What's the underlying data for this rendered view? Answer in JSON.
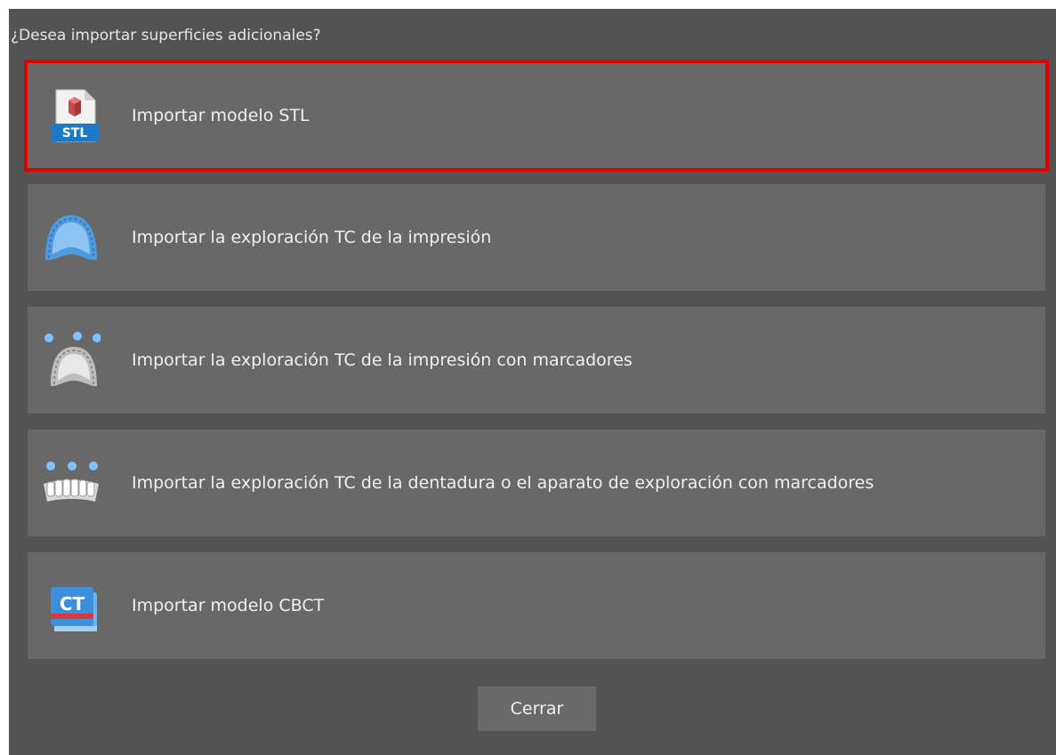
{
  "dialog": {
    "question": "¿Desea importar superficies adicionales?",
    "options": [
      {
        "label": "Importar modelo STL",
        "icon": "stl-file-icon",
        "selected": true
      },
      {
        "label": "Importar la exploración TC de la impresión",
        "icon": "impression-icon",
        "selected": false
      },
      {
        "label": "Importar la exploración TC de la impresión con marcadores",
        "icon": "impression-markers-icon",
        "selected": false
      },
      {
        "label": "Importar la exploración TC de la dentadura o el aparato de exploración con marcadores",
        "icon": "denture-markers-icon",
        "selected": false
      },
      {
        "label": "Importar modelo CBCT",
        "icon": "cbct-icon",
        "selected": false
      }
    ],
    "close_label": "Cerrar",
    "icon_badges": {
      "stl": "STL",
      "ct": "CT"
    }
  },
  "colors": {
    "dialog_bg": "#535353",
    "option_bg": "#686868",
    "selection_border": "#e00000",
    "text": "#f0f0f0"
  }
}
